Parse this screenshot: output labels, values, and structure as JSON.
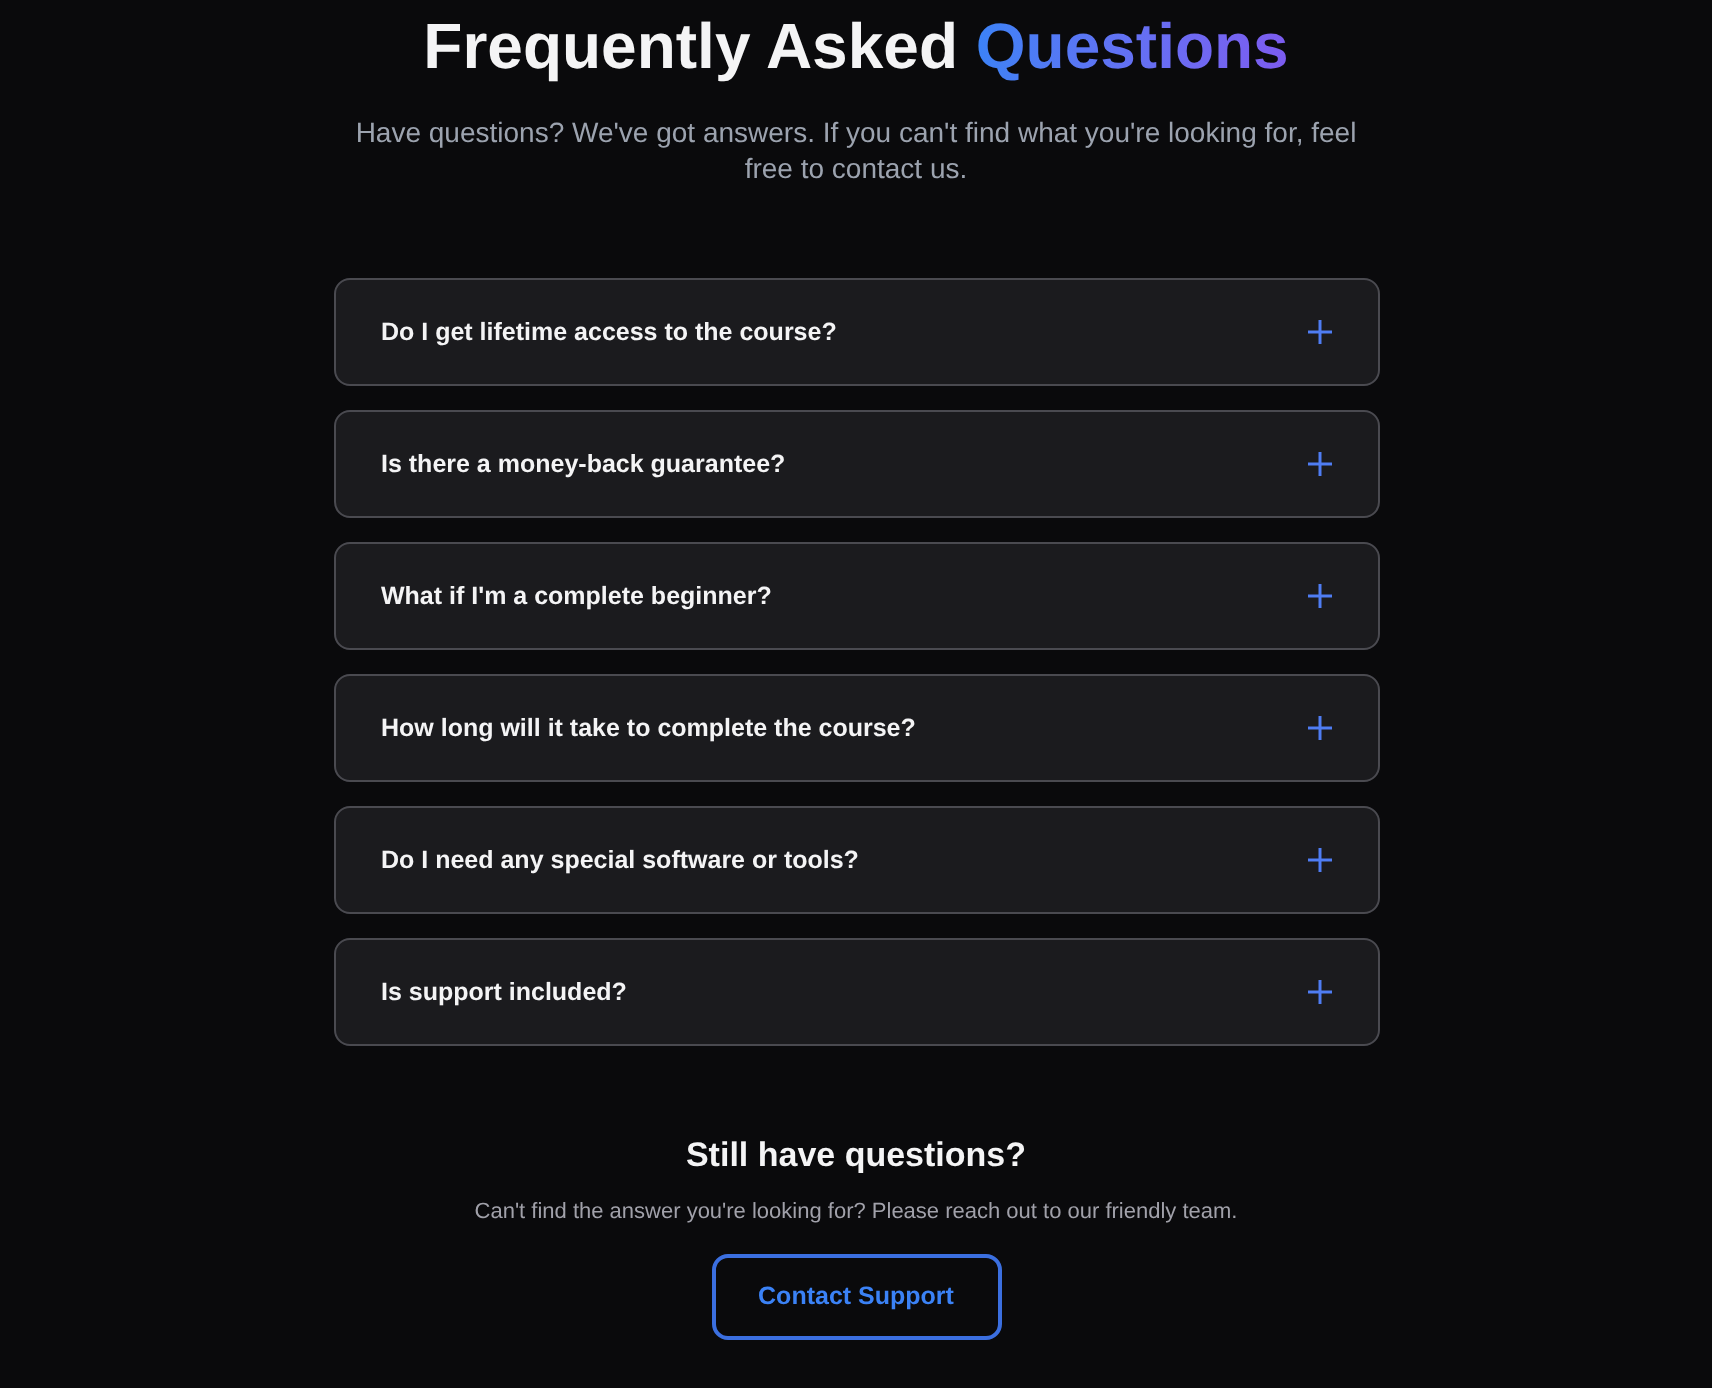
{
  "header": {
    "title": "Frequently Asked",
    "title_highlight": "Questions",
    "subtitle": "Have questions? We've got answers. If you can't find what you're looking for, feel free to contact us."
  },
  "faq": [
    {
      "question": "Do I get lifetime access to the course?",
      "expanded": false
    },
    {
      "question": "Is there a money-back guarantee?",
      "expanded": false
    },
    {
      "question": "What if I'm a complete beginner?",
      "expanded": false
    },
    {
      "question": "How long will it take to complete the course?",
      "expanded": false
    },
    {
      "question": "Do I need any special software or tools?",
      "expanded": false
    },
    {
      "question": "Is support included?",
      "expanded": false
    }
  ],
  "contact": {
    "title": "Still have questions?",
    "text": "Can't find the answer you're looking for? Please reach out to our friendly team.",
    "button": "Contact Support"
  }
}
